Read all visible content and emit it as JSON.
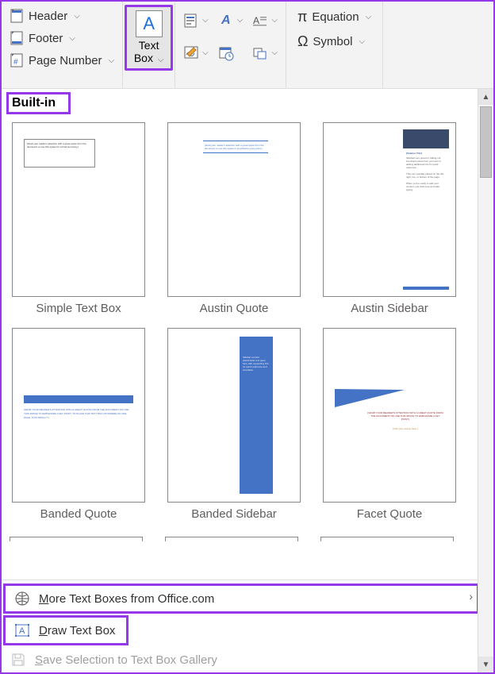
{
  "ribbon": {
    "header_label": "Header",
    "footer_label": "Footer",
    "page_number_label": "Page Number",
    "text_box_label": "Text\nBox",
    "equation_label": "Equation",
    "symbol_label": "Symbol"
  },
  "gallery": {
    "section_title": "Built-in",
    "items": [
      {
        "label": "Simple Text Box"
      },
      {
        "label": "Austin Quote"
      },
      {
        "label": "Austin Sidebar"
      },
      {
        "label": "Banded Quote"
      },
      {
        "label": "Banded Sidebar"
      },
      {
        "label": "Facet Quote"
      }
    ]
  },
  "bottom": {
    "more_label": "More Text Boxes from Office.com",
    "draw_label": "Draw Text Box",
    "save_label": "Save Selection to Text Box Gallery"
  },
  "preview_text": {
    "sidebar_title": "[Sidebar Title]"
  }
}
